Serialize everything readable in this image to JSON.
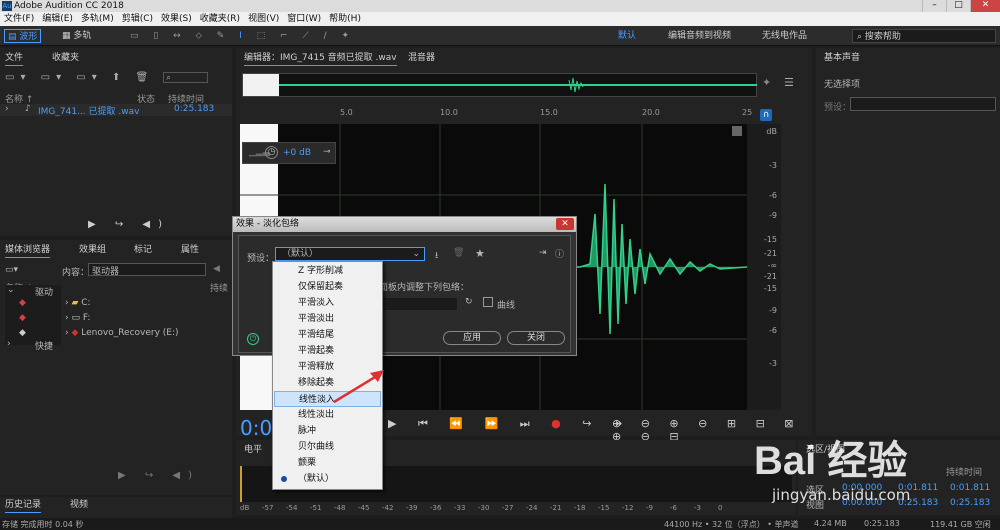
{
  "window": {
    "title": "Adobe Audition CC 2018"
  },
  "menu": [
    "文件(F)",
    "编辑(E)",
    "多轨(M)",
    "剪辑(C)",
    "效果(S)",
    "收藏夹(R)",
    "视图(V)",
    "窗口(W)",
    "帮助(H)"
  ],
  "toolbar": {
    "waveform": "波形",
    "multitrack": "多轨",
    "workspace_default": "默认",
    "workspace_edit_video": "编辑音频到视频",
    "workspace_radio": "无线电作品",
    "search_placeholder": "搜索帮助"
  },
  "files_panel": {
    "tab_files": "文件",
    "tab_favorites": "收藏夹",
    "col_name": "名称 ↑",
    "col_status": "状态",
    "col_duration": "持续时间",
    "file_name": "IMG_741... 已提取 .wav",
    "file_duration": "0:25.183"
  },
  "media_panel": {
    "tab_media": "媒体浏览器",
    "tab_effects": "效果组",
    "tab_markers": "标记",
    "tab_props": "属性",
    "content_label": "内容：",
    "content_value": "驱动器",
    "col_name": "名称 ↑",
    "col_duration": "持续",
    "tree_drive": "驱动",
    "tree_shortcut": "快捷",
    "drives": [
      "C:",
      "F:",
      "Lenovo_Recovery (E:)"
    ]
  },
  "history_panel": {
    "tab_history": "历史记录",
    "tab_video": "视频",
    "status": "存储 完成用时 0.04 秒"
  },
  "editor": {
    "tab_editor": "编辑器：IMG_7415 音频已提取 .wav",
    "tab_mixer": "混音器",
    "ruler_ticks": [
      "5.0",
      "10.0",
      "15.0",
      "20.0",
      "25"
    ],
    "db_labels": [
      "dB",
      "-3",
      "-6",
      "-9",
      "-15",
      "-21",
      "-∞",
      "-21",
      "-15",
      "-9",
      "-6",
      "-3"
    ],
    "volume_value": "+0 dB",
    "time_value": "0:00.000",
    "level_label": "电平"
  },
  "level_ticks": [
    "dB",
    "-57",
    "-54",
    "-51",
    "-48",
    "-45",
    "-42",
    "-39",
    "-36",
    "-33",
    "-30",
    "-27",
    "-24",
    "-21",
    "-18",
    "-15",
    "-12",
    "-9",
    "-6",
    "-3",
    "0"
  ],
  "selection_panel": {
    "title": "选区/视图",
    "col_duration": "持续时间",
    "row_selection": "选区",
    "row_view": "视图",
    "sel_start": "0:00.000",
    "sel_end": "0:01.811",
    "sel_dur": "0:01.811",
    "view_start": "0:00.000",
    "view_end": "0:25.183",
    "view_dur": "0:25.183"
  },
  "essential_sound": {
    "title": "基本声音",
    "no_selection": "无选择项",
    "preset_label": "预设："
  },
  "dialog": {
    "title": "效果 - 淡化包络",
    "preset_label": "预设：",
    "preset_value": "（默认）",
    "hint_text": "面板内调整下列包络：",
    "curve_label": "曲线",
    "apply_button": "应用",
    "close_button": "关闭"
  },
  "preset_menu": {
    "items": [
      "Z 字形削减",
      "仅保留起奏",
      "平滑淡入",
      "平滑淡出",
      "平滑结尾",
      "平滑起奏",
      "平滑释放",
      "移除起奏",
      "线性淡入",
      "线性淡出",
      "脉冲",
      "贝尔曲线",
      "颤栗",
      "（默认）"
    ],
    "selected_index": 8,
    "checked_index": 13
  },
  "status": {
    "samplerate": "44100 Hz • 32 位（浮点） • 单声道",
    "size": "4.24 MB",
    "duration": "0:25.183",
    "free": "119.41 GB 空闲"
  },
  "watermark": {
    "brand": "Bai 经验",
    "url": "jingyan.baidu.com"
  },
  "colors": {
    "waveform": "#2fd28a",
    "accent": "#4a9dff",
    "arrow": "#e03030"
  }
}
